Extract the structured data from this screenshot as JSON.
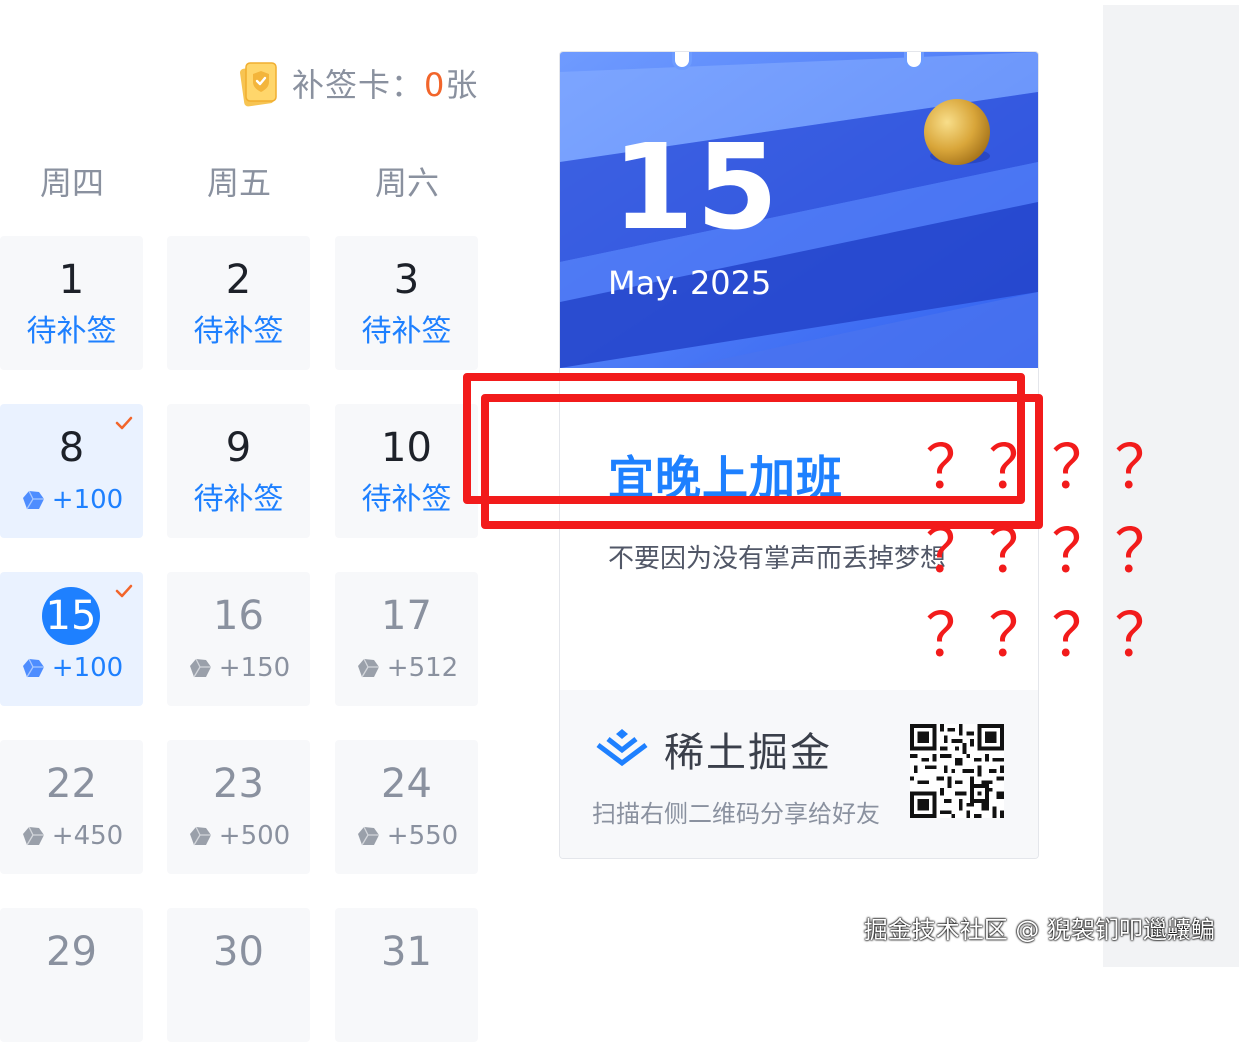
{
  "makeup_card": {
    "label": "补签卡：",
    "count": "0",
    "unit": "张"
  },
  "weekdays": [
    "周四",
    "周五",
    "周六"
  ],
  "calendar": [
    [
      {
        "day": "1",
        "status": "待补签"
      },
      {
        "day": "2",
        "status": "待补签"
      },
      {
        "day": "3",
        "status": "待补签"
      }
    ],
    [
      {
        "day": "8",
        "reward": "+100",
        "signed": true
      },
      {
        "day": "9",
        "status": "待补签"
      },
      {
        "day": "10",
        "status": "待补签"
      }
    ],
    [
      {
        "day": "15",
        "reward": "+100",
        "signed": true,
        "today": true
      },
      {
        "day": "16",
        "reward": "+150"
      },
      {
        "day": "17",
        "reward": "+512"
      }
    ],
    [
      {
        "day": "22",
        "reward": "+450"
      },
      {
        "day": "23",
        "reward": "+500"
      },
      {
        "day": "24",
        "reward": "+550"
      }
    ],
    [
      {
        "day": "29"
      },
      {
        "day": "30"
      },
      {
        "day": "31"
      }
    ]
  ],
  "calendar_card": {
    "day": "15",
    "month": "May. 2025",
    "fortune": "宜晚上加班",
    "quote": "不要因为没有掌声而丢掉梦想",
    "brand": "稀土掘金",
    "share_text": "扫描右侧二维码分享给好友"
  },
  "annotation": {
    "marks": [
      "？",
      "？",
      "？",
      "？",
      "？",
      "？",
      "？",
      "？",
      "？",
      "？",
      "？",
      "？"
    ]
  },
  "watermark": "掘金技术社区 @ 猊袈钔叩邋齉鳊",
  "colors": {
    "accent": "#1e80ff",
    "annotation": "#f21b1b",
    "checkmark": "#f2652b"
  },
  "icons": {
    "makeup_card": "makeup-card-icon",
    "ore": "ore-icon",
    "check": "check-icon",
    "brand": "juejin-logo",
    "qr": "qr-code"
  }
}
